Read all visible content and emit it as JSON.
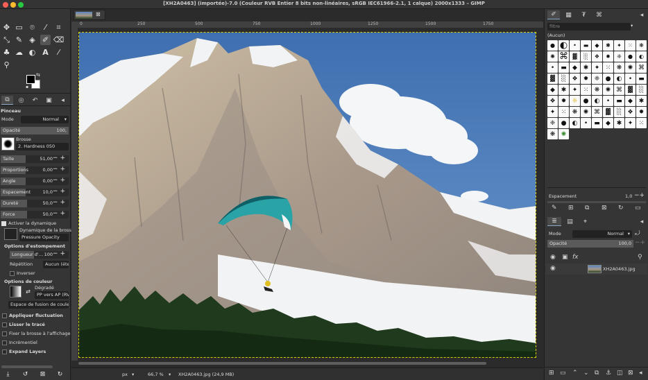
{
  "window": {
    "title": "[XH2A0463] (importée)-7.0 (Couleur RVB Entier 8 bits non-linéaires, sRGB IEC61966-2.1, 1 calque) 2000x1333 – GIMP",
    "traffic_colors": [
      "#ff5f57",
      "#febc2e",
      "#28c840"
    ]
  },
  "toolbox": {
    "tools": [
      "move-tool-icon",
      "rect-select-icon",
      "free-select-icon",
      "fuzzy-select-icon",
      "crop-icon",
      "transform-icon",
      "warp-icon",
      "text-icon",
      "bucket-fill-icon",
      "paintbrush-icon",
      "eraser-icon",
      "clone-icon",
      "smudge-icon",
      "dodge-icon",
      "text-tool-icon",
      "color-picker-icon",
      "zoom-icon"
    ],
    "fg_color": "#000000",
    "bg_color": "#ffffff"
  },
  "tool_options": {
    "title": "Pinceau",
    "mode_label": "Mode",
    "mode_value": "Normal",
    "opacity_label": "Opacité",
    "opacity_value": "100,",
    "brush_label": "Brosse",
    "brush_value": "2. Hardness 050",
    "sliders": [
      {
        "name": "Taille",
        "value": "51,00",
        "fill": 0.18
      },
      {
        "name": "Proportions",
        "value": "0,00",
        "fill": 0.0
      },
      {
        "name": "Angle",
        "value": "0,00",
        "fill": 0.0
      },
      {
        "name": "Espacement",
        "value": "10,0",
        "fill": 0.1
      },
      {
        "name": "Dureté",
        "value": "50,0",
        "fill": 0.5
      },
      {
        "name": "Force",
        "value": "50,0",
        "fill": 0.5
      }
    ],
    "dynamics_toggle": "Activer la dynamique",
    "dynamics_label": "Dynamique de la brosse",
    "dynamics_value": "Pressure Opacity",
    "fade_title": "Options d'estompement",
    "fade_length_label": "Longueur d'…",
    "fade_length_value": "100",
    "repeat_label": "Répétition",
    "repeat_value": "Aucun (éte",
    "invert_label": "Inverser",
    "color_title": "Options de couleur",
    "gradient_label": "Dégradé",
    "gradient_value": "PP vers AP (RV",
    "blend_space": "Espace de fusion de couleu",
    "checks": [
      "Appliquer fluctuation",
      "Lisser le tracé",
      "Fixer la brosse à l'affichage",
      "Incrémentiel",
      "Expand Layers"
    ]
  },
  "canvas": {
    "ruler_marks": [
      "0",
      "250",
      "500",
      "750",
      "1000",
      "1250",
      "1500",
      "1750"
    ],
    "status_unit": "px",
    "status_zoom": "66,7 %",
    "status_file": "XH2A0463.jpg (24,9 MB)"
  },
  "brushes_panel": {
    "filter_placeholder": "filtre",
    "selected": "(Aucun)",
    "spacing_label": "Espacement",
    "spacing_value": "1,0"
  },
  "layers_panel": {
    "mode_label": "Mode",
    "mode_value": "Normal",
    "opacity_label": "Opacité",
    "opacity_value": "100,0",
    "layer_name": "XH2A0463.jpg"
  }
}
